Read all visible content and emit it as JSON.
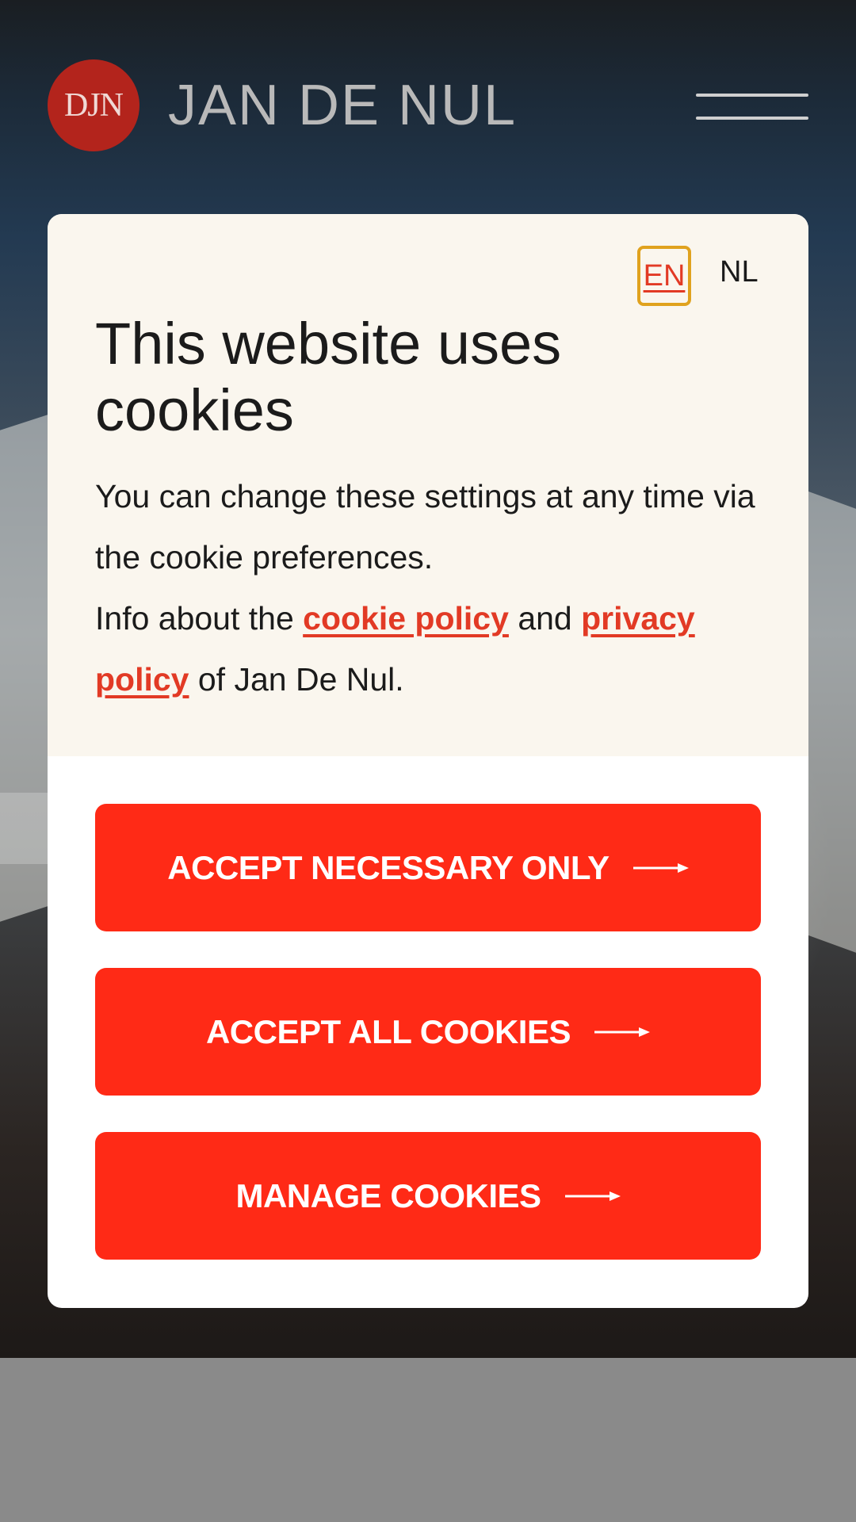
{
  "header": {
    "logo_mark": "DJN",
    "logo_text": "JAN DE NUL"
  },
  "cookie_modal": {
    "languages": {
      "en": "EN",
      "nl": "NL"
    },
    "title": "This website uses cookies",
    "body": {
      "line1": "You can change these settings at any time via the cookie preferences.",
      "info_prefix": "Info about the ",
      "cookie_policy_link": "cookie policy",
      "and": " and ",
      "privacy_policy_link": "privacy policy",
      "suffix": " of Jan De Nul."
    },
    "buttons": {
      "accept_necessary": "ACCEPT NECESSARY ONLY",
      "accept_all": "ACCEPT ALL COOKIES",
      "manage": "MANAGE COOKIES"
    }
  },
  "colors": {
    "accent": "#ff2a16",
    "link": "#e23a25",
    "focus_ring": "#e0a21e",
    "modal_top_bg": "#faf6ee"
  },
  "icons": [
    "hamburger-menu-icon",
    "arrow-right-icon"
  ]
}
